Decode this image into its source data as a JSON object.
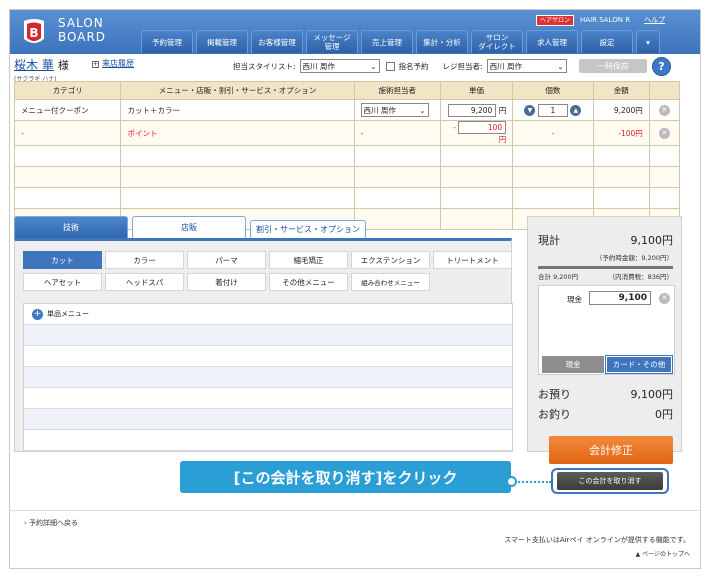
{
  "header": {
    "logo_line1": "SALON",
    "logo_line2": "BOARD",
    "badge": "ヘアサロン",
    "salon_name": "HAIR SALON R",
    "help": "ヘルプ",
    "nav": [
      "予約管理",
      "掲載管理",
      "お客様管理",
      "メッセージ\n管理",
      "売上管理",
      "集計・分析",
      "サロン\nダイレクト",
      "求人管理",
      "設定"
    ],
    "menu_icon": "chevron-down-icon"
  },
  "customer": {
    "name": "桜木 華",
    "honorific": "様",
    "kana": "(サクラギ ハナ)",
    "visit_history": "来店履歴",
    "visit_icon": "plus-square-icon"
  },
  "topform": {
    "stylist_label": "担当スタイリスト:",
    "stylist_value": "西川 周作",
    "nominate_label": "指名予約",
    "register_label": "レジ担当者:",
    "register_value": "西川 周作",
    "temp_save": "一時保存",
    "help_icon": "?"
  },
  "table": {
    "headers": [
      "カテゴリ",
      "メニュー・店販・割引・サービス・オプション",
      "施術担当者",
      "単価",
      "個数",
      "金額",
      ""
    ],
    "row1": {
      "category": "メニュー付クーポン",
      "menu": "カット＋カラー",
      "staff": "西川 周作",
      "price": "9,200",
      "yen": "円",
      "qty": "1",
      "amount": "9,200円"
    },
    "row2": {
      "category": "-",
      "menu": "ポイント",
      "staff": "-",
      "minus": "-",
      "price": "100",
      "yen": "円",
      "qty": "-",
      "amount": "-100円"
    }
  },
  "tabs": [
    "技術",
    "店販",
    "割引・サービス・オプション"
  ],
  "categories": [
    "カット",
    "カラー",
    "パーマ",
    "縮毛矯正",
    "エクステンション",
    "トリートメント",
    "ヘアセット",
    "ヘッドスパ",
    "着付け",
    "その他メニュー",
    "組み合わせメニュー"
  ],
  "menu_list": {
    "single": "単品メニュー"
  },
  "summary": {
    "genkei_label": "現計",
    "genkei_value": "9,100円",
    "reserve_total": "（予約時金額：9,200円）",
    "total_label": "合計",
    "total_value": "9,200円",
    "tax": "（内消費税：836円）",
    "cash_label": "現金",
    "cash_value": "9,100",
    "btn_cash": "現金",
    "btn_card": "カード・その他",
    "deposit_label": "お預り",
    "deposit_value": "9,100円",
    "change_label": "お釣り",
    "change_value": "0円",
    "correct": "会計修正",
    "cancel": "この会計を取り消す"
  },
  "callout": "[この会計を取り消す]をクリック",
  "footer": {
    "back": "予約詳細へ戻る",
    "smart": "スマート支払いはAirペイ オンラインが提供する機能です。",
    "pagetop": "ページのトップへ"
  },
  "colors": {
    "brand": "#3d73bb",
    "accent": "#e06514",
    "callout": "#2a9fd6"
  }
}
